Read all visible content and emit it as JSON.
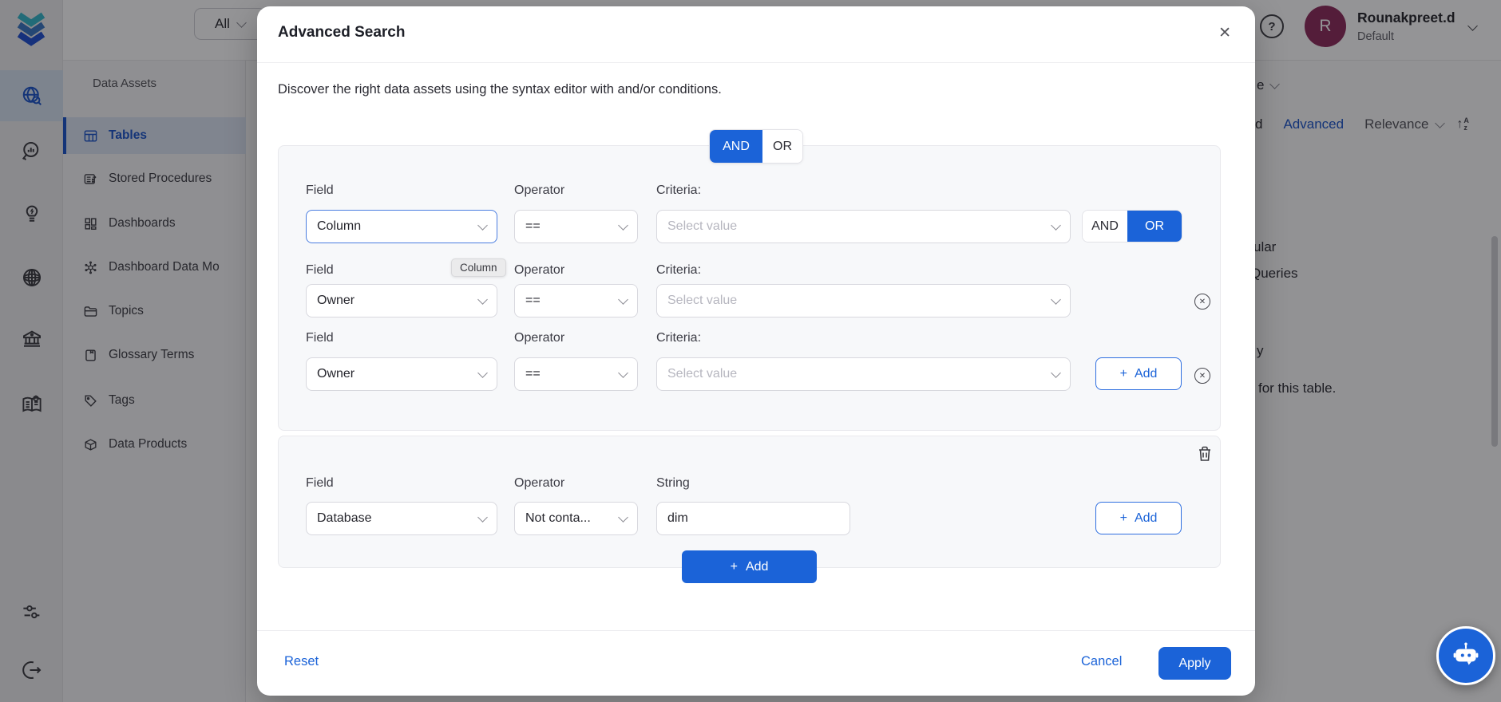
{
  "topbar": {
    "filter_all": "All",
    "help_glyph": "?",
    "user": {
      "initial": "R",
      "name": "Rounakpreet.d",
      "org": "Default"
    }
  },
  "sidebar": {
    "title": "Data Assets",
    "items": [
      {
        "label": "Tables",
        "selected": true
      },
      {
        "label": "Stored Procedures",
        "selected": false
      },
      {
        "label": "Dashboards",
        "selected": false
      },
      {
        "label": "Dashboard Data Mo",
        "selected": false
      },
      {
        "label": "Topics",
        "selected": false
      },
      {
        "label": "Glossary Terms",
        "selected": false
      },
      {
        "label": "Tags",
        "selected": false
      },
      {
        "label": "Data Products",
        "selected": false
      }
    ]
  },
  "background": {
    "partial_dropdown": "e",
    "partial_saved": "d",
    "advanced": "Advanced",
    "relevance": "Relevance",
    "sort_arrow": "↑",
    "sort_a": "A",
    "sort_z": "z",
    "partial_popular": "ular",
    "partial_queries": "Queries",
    "partial_y": "y",
    "partial_table_note": "for this table."
  },
  "modal": {
    "title": "Advanced Search",
    "close_glyph": "✕",
    "subtitle": "Discover the right data assets using the syntax editor with and/or conditions.",
    "toggle": {
      "and": "AND",
      "or": "OR",
      "selected": "AND"
    },
    "labels": {
      "field": "Field",
      "operator": "Operator",
      "criteria": "Criteria:",
      "string": "String",
      "plus": "+",
      "add": "Add"
    },
    "placeholder_select": "Select value",
    "remove_glyph": "✕",
    "rows": [
      {
        "field": "Column",
        "operator": "==",
        "joiner_selected": "OR"
      },
      {
        "field": "Owner",
        "operator": "==",
        "tooltip": "Column"
      },
      {
        "field": "Owner",
        "operator": "=="
      }
    ],
    "group2": {
      "field": "Database",
      "operator": "Not conta...",
      "string_value": "dim"
    },
    "footer": {
      "reset": "Reset",
      "cancel": "Cancel",
      "apply": "Apply"
    }
  },
  "colors": {
    "accent": "#1b63d8",
    "avatar": "#8d2c5c",
    "selected_row": "#dbe5f2",
    "overlay": "rgba(12,12,16,0.44)"
  }
}
